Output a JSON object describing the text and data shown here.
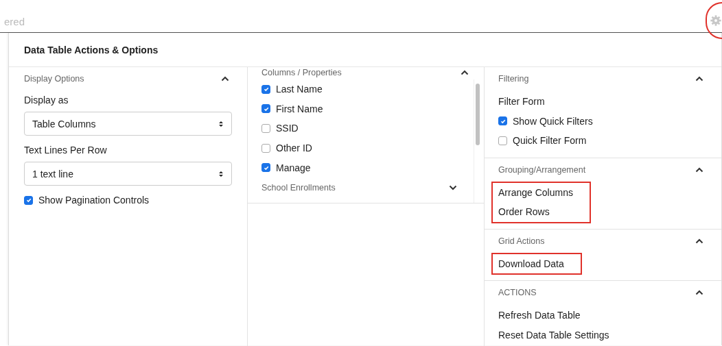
{
  "search": {
    "placeholder": "ered"
  },
  "settings": {
    "highlighted": true
  },
  "panel": {
    "title": "Data Table Actions & Options",
    "display_options": {
      "title": "Display Options",
      "expanded": true,
      "fields": [
        {
          "label": "Display as",
          "value": "Table Columns"
        },
        {
          "label": "Text Lines Per Row",
          "value": "1 text line"
        }
      ],
      "checkbox": {
        "label": "Show Pagination Controls",
        "checked": true
      }
    },
    "columns": {
      "title": "Columns / Properties",
      "expanded": true,
      "items": [
        {
          "label": "Last Name",
          "checked": true
        },
        {
          "label": "First Name",
          "checked": true
        },
        {
          "label": "SSID",
          "checked": false
        },
        {
          "label": "Other ID",
          "checked": false
        },
        {
          "label": "Manage",
          "checked": true
        }
      ],
      "next_section": {
        "title": "School Enrollments",
        "expanded": false
      }
    },
    "sections": [
      {
        "title": "Filtering",
        "expanded": true,
        "highlighted": false,
        "items": [
          {
            "kind": "link",
            "label": "Filter Form"
          },
          {
            "kind": "checkbox",
            "label": "Show Quick Filters",
            "checked": true
          },
          {
            "kind": "checkbox",
            "label": "Quick Filter Form",
            "checked": false
          }
        ]
      },
      {
        "title": "Grouping/Arrangement",
        "expanded": true,
        "highlighted": true,
        "items": [
          {
            "kind": "link",
            "label": "Arrange Columns"
          },
          {
            "kind": "link",
            "label": "Order Rows"
          }
        ]
      },
      {
        "title": "Grid Actions",
        "expanded": true,
        "highlighted": true,
        "items": [
          {
            "kind": "link",
            "label": "Download Data"
          }
        ]
      },
      {
        "title": "ACTIONS",
        "expanded": true,
        "highlighted": false,
        "items": [
          {
            "kind": "link",
            "label": "Refresh Data Table"
          },
          {
            "kind": "link",
            "label": "Reset Data Table Settings"
          }
        ]
      }
    ]
  }
}
